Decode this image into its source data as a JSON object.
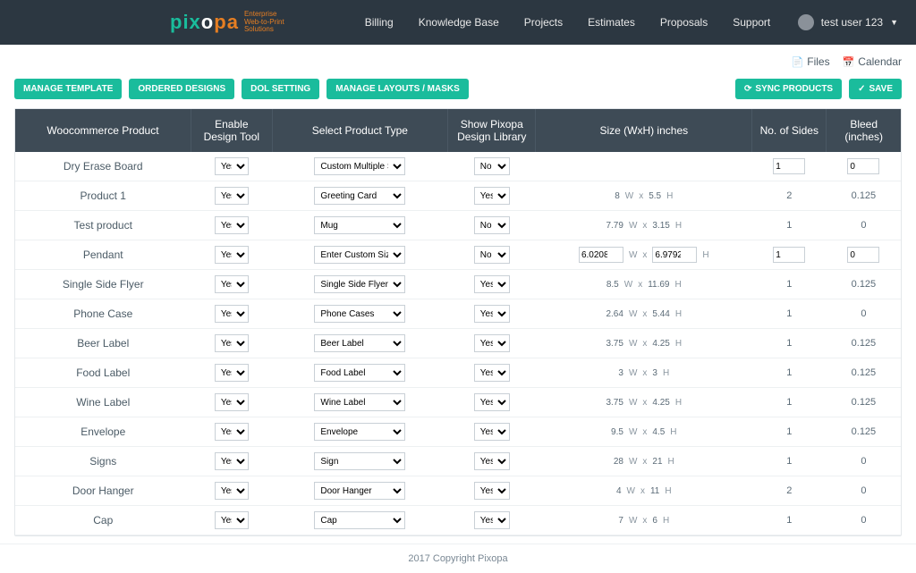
{
  "header": {
    "brand_part1": "pix",
    "brand_part2": "o",
    "brand_part3": "pa",
    "tagline_l1": "Enterprise",
    "tagline_l2": "Web-to-Print",
    "tagline_l3": "Solutions",
    "nav": [
      "Billing",
      "Knowledge Base",
      "Projects",
      "Estimates",
      "Proposals",
      "Support"
    ],
    "user": "test user 123"
  },
  "toplinks": {
    "files": "Files",
    "calendar": "Calendar"
  },
  "toolbar": {
    "manage_template": "MANAGE TEMPLATE",
    "ordered_designs": "ORDERED DESIGNS",
    "dol_setting": "DOL SETTING",
    "manage_layouts": "MANAGE LAYOUTS / MASKS",
    "sync": "SYNC PRODUCTS",
    "save": "SAVE"
  },
  "columns": {
    "product": "Woocommerce Product",
    "enable": "Enable Design Tool",
    "type": "Select Product Type",
    "library": "Show Pixopa Design Library",
    "size": "Size (WxH) inches",
    "sides": "No. of Sides",
    "bleed": "Bleed (inches)"
  },
  "rows": [
    {
      "name": "Dry Erase Board",
      "enable": "Yes",
      "type": "Custom Multiple Sizes (Pick",
      "lib": "No",
      "w": "",
      "h": "",
      "sides_input": "1",
      "bleed_input": "0",
      "size_editable": false,
      "has_inputs": true
    },
    {
      "name": "Product 1",
      "enable": "Yes",
      "type": "Greeting Card",
      "lib": "Yes",
      "w": "8",
      "h": "5.5",
      "sides": "2",
      "bleed": "0.125",
      "size_editable": false,
      "has_inputs": false
    },
    {
      "name": "Test product",
      "enable": "Yes",
      "type": "Mug",
      "lib": "No",
      "w": "7.79",
      "h": "3.15",
      "sides": "1",
      "bleed": "0",
      "size_editable": false,
      "has_inputs": false
    },
    {
      "name": "Pendant",
      "enable": "Yes",
      "type": "Enter Custom Size",
      "lib": "No",
      "w": "6.0208",
      "h": "6.9792",
      "sides_input": "1",
      "bleed_input": "0",
      "size_editable": true,
      "has_inputs": true
    },
    {
      "name": "Single Side Flyer",
      "enable": "Yes",
      "type": "Single Side Flyer",
      "lib": "Yes",
      "w": "8.5",
      "h": "11.69",
      "sides": "1",
      "bleed": "0.125",
      "size_editable": false,
      "has_inputs": false
    },
    {
      "name": "Phone Case",
      "enable": "Yes",
      "type": "Phone Cases",
      "lib": "Yes",
      "w": "2.64",
      "h": "5.44",
      "sides": "1",
      "bleed": "0",
      "size_editable": false,
      "has_inputs": false
    },
    {
      "name": "Beer Label",
      "enable": "Yes",
      "type": "Beer Label",
      "lib": "Yes",
      "w": "3.75",
      "h": "4.25",
      "sides": "1",
      "bleed": "0.125",
      "size_editable": false,
      "has_inputs": false
    },
    {
      "name": "Food Label",
      "enable": "Yes",
      "type": "Food Label",
      "lib": "Yes",
      "w": "3",
      "h": "3",
      "sides": "1",
      "bleed": "0.125",
      "size_editable": false,
      "has_inputs": false
    },
    {
      "name": "Wine Label",
      "enable": "Yes",
      "type": "Wine Label",
      "lib": "Yes",
      "w": "3.75",
      "h": "4.25",
      "sides": "1",
      "bleed": "0.125",
      "size_editable": false,
      "has_inputs": false
    },
    {
      "name": "Envelope",
      "enable": "Yes",
      "type": "Envelope",
      "lib": "Yes",
      "w": "9.5",
      "h": "4.5",
      "sides": "1",
      "bleed": "0.125",
      "size_editable": false,
      "has_inputs": false
    },
    {
      "name": "Signs",
      "enable": "Yes",
      "type": "Sign",
      "lib": "Yes",
      "w": "28",
      "h": "21",
      "sides": "1",
      "bleed": "0",
      "size_editable": false,
      "has_inputs": false
    },
    {
      "name": "Door Hanger",
      "enable": "Yes",
      "type": "Door Hanger",
      "lib": "Yes",
      "w": "4",
      "h": "11",
      "sides": "2",
      "bleed": "0",
      "size_editable": false,
      "has_inputs": false
    },
    {
      "name": "Cap",
      "enable": "Yes",
      "type": "Cap",
      "lib": "Yes",
      "w": "7",
      "h": "6",
      "sides": "1",
      "bleed": "0",
      "size_editable": false,
      "has_inputs": false
    }
  ],
  "labels": {
    "w": "W",
    "h": "H",
    "x": "x"
  },
  "footer": "2017 Copyright Pixopa"
}
